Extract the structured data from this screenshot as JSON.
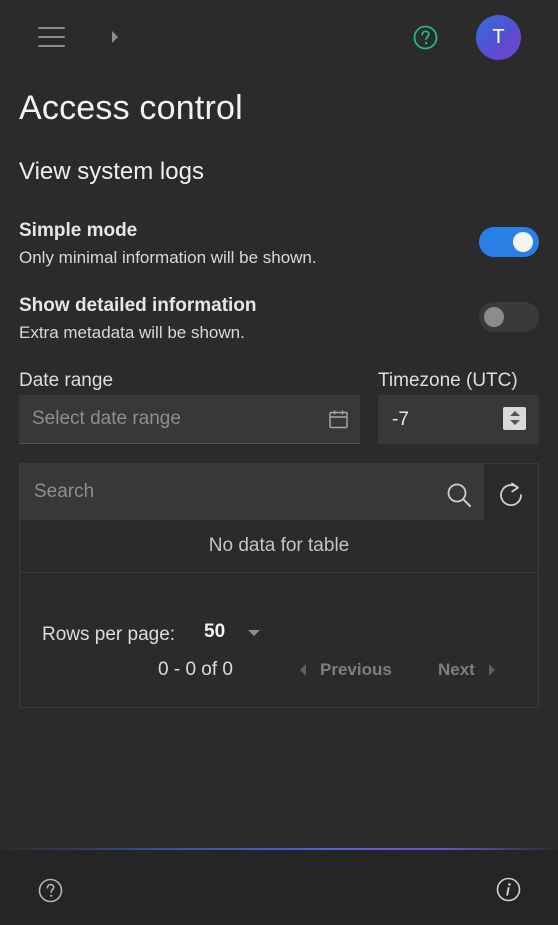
{
  "header": {
    "help_icon": "help-circle-icon",
    "avatar_initial": "T"
  },
  "page": {
    "title": "Access control",
    "section_title": "View system logs"
  },
  "options": {
    "simple_mode": {
      "title": "Simple mode",
      "description": "Only minimal information will be shown.",
      "enabled": true
    },
    "detailed_info": {
      "title": "Show detailed information",
      "description": "Extra metadata will be shown.",
      "enabled": false
    }
  },
  "filters": {
    "date_range": {
      "label": "Date range",
      "placeholder": "Select date range",
      "value": ""
    },
    "timezone": {
      "label": "Timezone (UTC)",
      "value": "-7"
    }
  },
  "table": {
    "search_placeholder": "Search",
    "empty_message": "No data for table",
    "rows_per_page_label": "Rows per page:",
    "rows_per_page_value": "50",
    "range_text": "0 - 0 of 0",
    "previous_label": "Previous",
    "next_label": "Next"
  },
  "colors": {
    "background": "#2b2b2c",
    "accent": "#2a7fe6",
    "help_icon": "#1fb98a",
    "avatar_gradient_start": "#2f6fdc",
    "avatar_gradient_end": "#7a43c8"
  }
}
